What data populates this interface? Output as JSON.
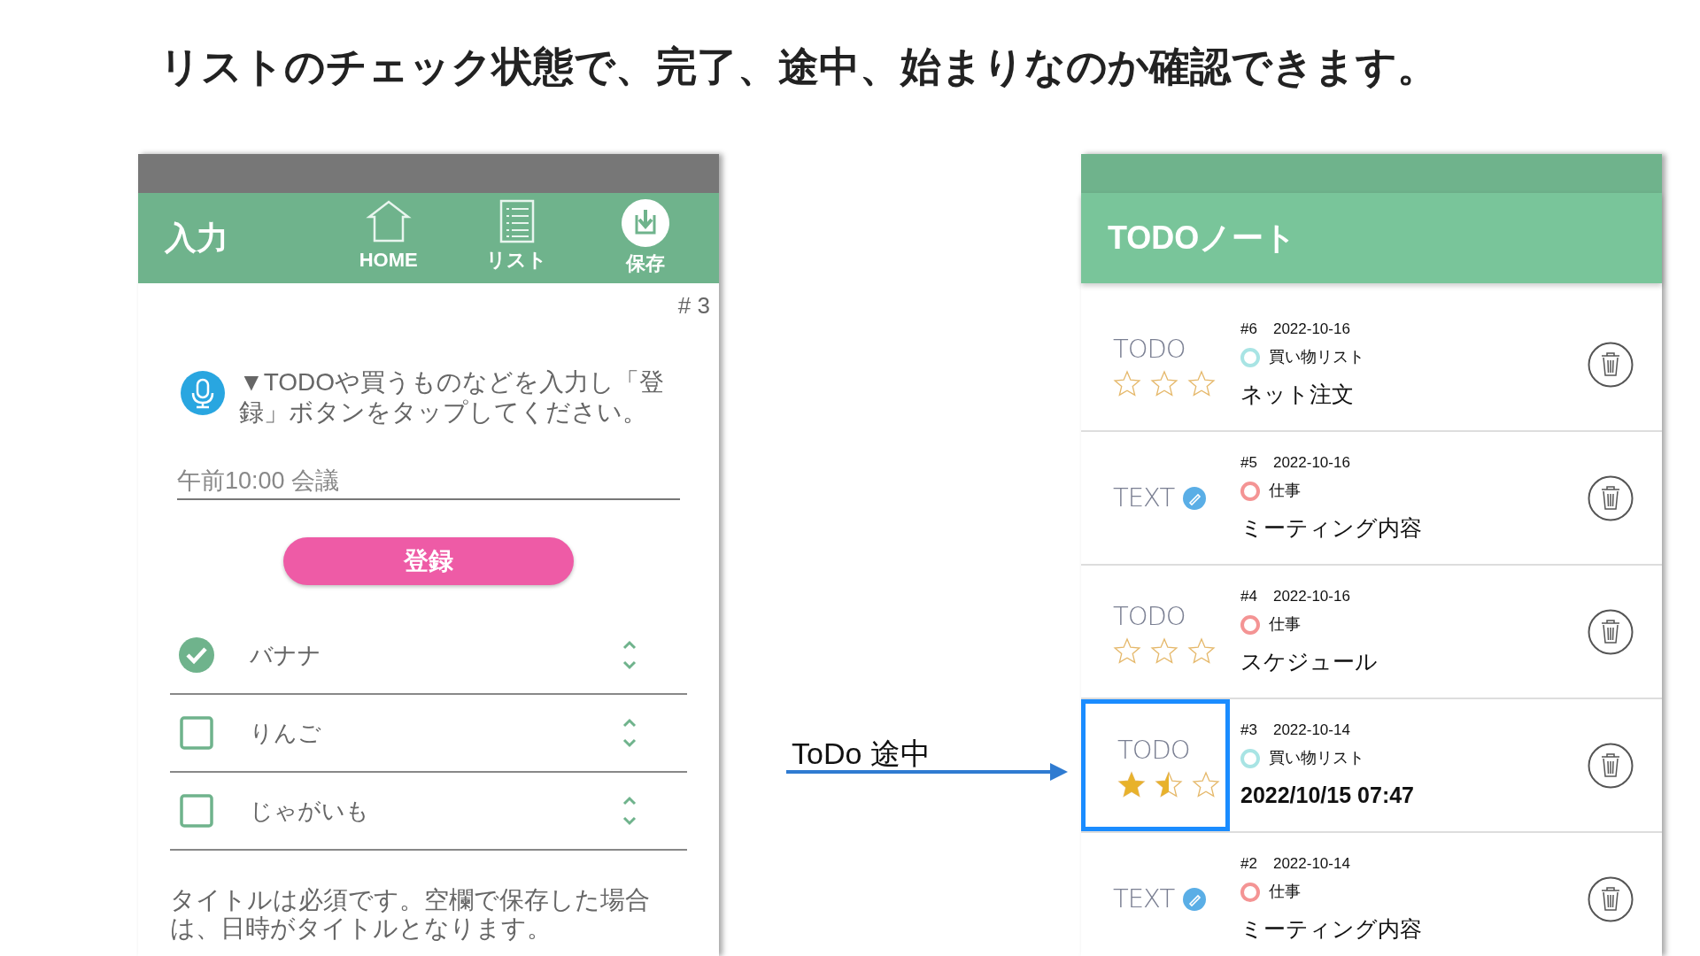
{
  "headline": "リストのチェック状態で、完了、途中、始まりなのか確認できます。",
  "input_screen": {
    "title": "入力",
    "nav": [
      {
        "kind": "home",
        "label": "HOME"
      },
      {
        "kind": "list",
        "label": "リスト"
      },
      {
        "kind": "save",
        "label": "保存"
      }
    ],
    "record_number": "# 3",
    "instruction": "▼TODOや買うものなどを入力し「登録」ボタンをタップしてください。",
    "input": {
      "placeholder": "午前10:00 会議"
    },
    "register_button": "登録",
    "items": [
      {
        "label": "バナナ",
        "checked": true
      },
      {
        "label": "りんご",
        "checked": false
      },
      {
        "label": "じゃがいも",
        "checked": false
      }
    ],
    "note": "タイトルは必須です。空欄で保存した場合は、日時がタイトルとなります。"
  },
  "annotation": {
    "label": "ToDo 途中"
  },
  "list_screen": {
    "title": "TODOノート",
    "notes": [
      {
        "kind": "todo",
        "type_label": "TODO",
        "stars": 0,
        "number": "#6",
        "date": "2022-10-16",
        "category": "買い物リスト",
        "color": "#a8e4e4",
        "title": "ネット注文",
        "selected": false
      },
      {
        "kind": "text",
        "type_label": "TEXT",
        "number": "#5",
        "date": "2022-10-16",
        "category": "仕事",
        "color": "#f49494",
        "title": "ミーティング内容",
        "selected": false
      },
      {
        "kind": "todo",
        "type_label": "TODO",
        "stars": 0,
        "number": "#4",
        "date": "2022-10-16",
        "category": "仕事",
        "color": "#f49494",
        "title": "スケジュール",
        "selected": false
      },
      {
        "kind": "todo",
        "type_label": "TODO",
        "stars": 1.5,
        "number": "#3",
        "date": "2022-10-14",
        "category": "買い物リスト",
        "color": "#a8e4e4",
        "title": "2022/10/15 07:47",
        "selected": true
      },
      {
        "kind": "text",
        "type_label": "TEXT",
        "number": "#2",
        "date": "2022-10-14",
        "category": "仕事",
        "color": "#f49494",
        "title": "ミーティング内容",
        "selected": false
      }
    ]
  }
}
